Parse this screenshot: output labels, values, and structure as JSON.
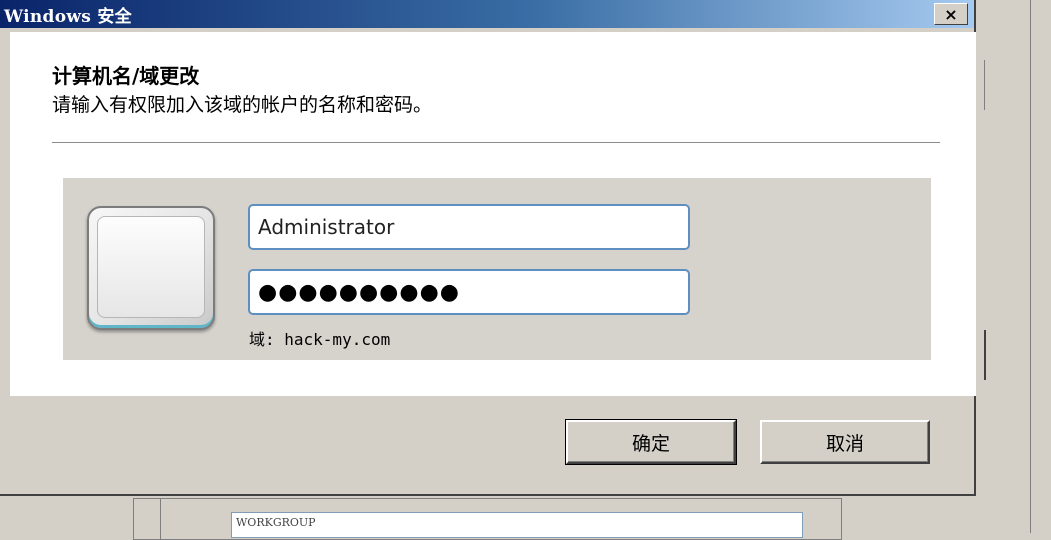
{
  "dialog": {
    "title": "Windows 安全",
    "close_glyph": "×",
    "heading": "计算机名/域更改",
    "subheading": "请输入有权限加入该域的帐户的名称和密码。",
    "username_value": "Administrator",
    "password_masked": "●●●●●●●●●●",
    "domain_label": "域: hack-my.com",
    "ok_label": "确定",
    "cancel_label": "取消"
  },
  "background": {
    "workgroup_value": "WORKGROUP"
  }
}
